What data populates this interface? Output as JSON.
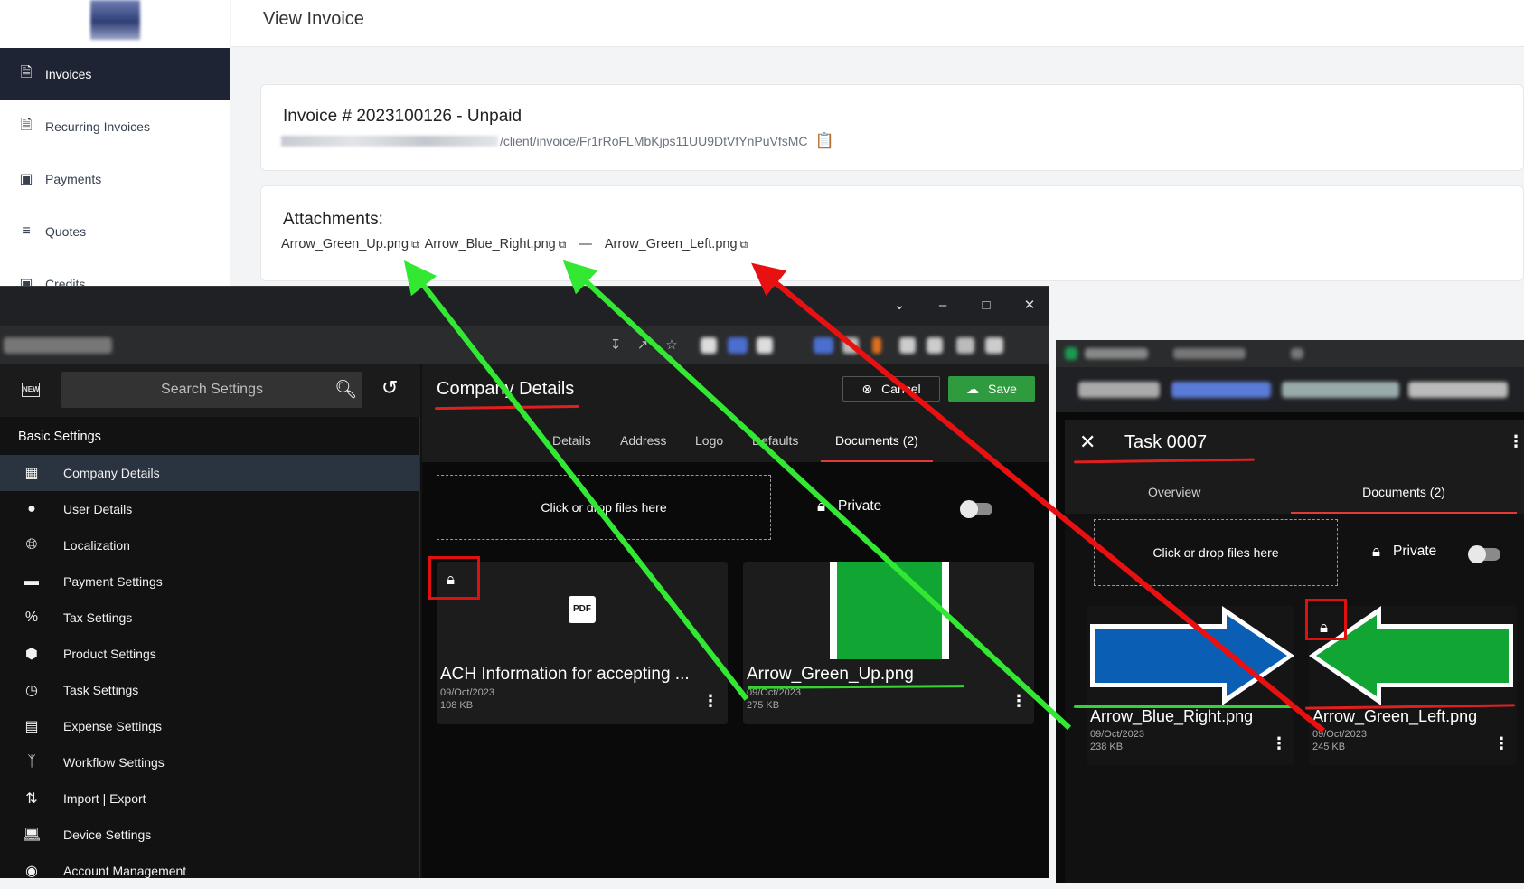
{
  "portal": {
    "page_title": "View Invoice",
    "nav": [
      {
        "label": "Invoices",
        "icon": "document-icon",
        "active": true
      },
      {
        "label": "Recurring Invoices",
        "icon": "document-icon",
        "active": false
      },
      {
        "label": "Payments",
        "icon": "credit-card-icon",
        "active": false
      },
      {
        "label": "Quotes",
        "icon": "list-icon",
        "active": false
      },
      {
        "label": "Credits",
        "icon": "credit-card-icon",
        "active": false
      }
    ],
    "invoice_heading": "Invoice # 2023100126 - Unpaid",
    "invoice_url_path": "/client/invoice/Fr1rRoFLMbKjps11UU9DtVfYnPuVfsMC",
    "attachments_heading": "Attachments:",
    "attachments": [
      "Arrow_Green_Up.png",
      "Arrow_Blue_Right.png",
      "—",
      "Arrow_Green_Left.png"
    ]
  },
  "app1": {
    "search_placeholder": "Search Settings",
    "section_heading": "Basic Settings",
    "settings": [
      {
        "label": "Company Details",
        "icon": "building-icon"
      },
      {
        "label": "User Details",
        "icon": "user-icon"
      },
      {
        "label": "Localization",
        "icon": "globe-icon"
      },
      {
        "label": "Payment Settings",
        "icon": "credit-card-icon"
      },
      {
        "label": "Tax Settings",
        "icon": "percent-icon"
      },
      {
        "label": "Product Settings",
        "icon": "cube-icon"
      },
      {
        "label": "Task Settings",
        "icon": "clock-icon"
      },
      {
        "label": "Expense Settings",
        "icon": "image-icon"
      },
      {
        "label": "Workflow Settings",
        "icon": "branch-icon"
      },
      {
        "label": "Import | Export",
        "icon": "swap-icon"
      },
      {
        "label": "Device Settings",
        "icon": "laptop-icon"
      },
      {
        "label": "Account Management",
        "icon": "account-icon"
      }
    ],
    "page_title": "Company Details",
    "cancel_label": "Cancel",
    "save_label": "Save",
    "tabs": [
      "Details",
      "Address",
      "Logo",
      "Defaults",
      "Documents (2)"
    ],
    "dropzone_text": "Click or drop files here",
    "private_label": "Private",
    "documents": [
      {
        "name": "ACH Information for accepting ...",
        "date": "09/Oct/2023",
        "size": "108 KB",
        "icon": "pdf-icon"
      },
      {
        "name": "Arrow_Green_Up.png",
        "date": "09/Oct/2023",
        "size": "275 KB",
        "icon": "image-thumb"
      }
    ],
    "new_icon_text": "NEW",
    "pdf_icon_text": "PDF"
  },
  "app2": {
    "task_title": "Task 0007",
    "tabs": [
      "Overview",
      "Documents (2)"
    ],
    "dropzone_text": "Click or drop files here",
    "private_label": "Private",
    "documents": [
      {
        "name": "Arrow_Blue_Right.png",
        "date": "09/Oct/2023",
        "size": "238 KB"
      },
      {
        "name": "Arrow_Green_Left.png",
        "date": "09/Oct/2023",
        "size": "245 KB"
      }
    ]
  },
  "colors": {
    "accent_red": "#e02020",
    "annotation_green": "#33e833",
    "save_green": "#2e9b3e",
    "sidebar_dark": "#1e2433"
  }
}
